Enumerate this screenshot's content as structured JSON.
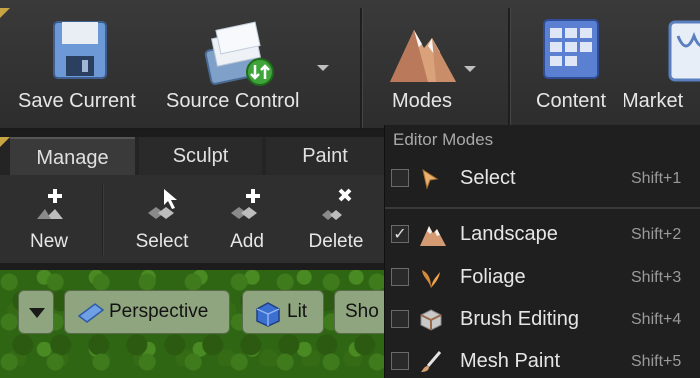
{
  "toolbar": {
    "save_current": "Save Current",
    "source_control": "Source Control",
    "modes": "Modes",
    "content": "Content",
    "marketplace": "Market"
  },
  "mode_tabs": [
    "Manage",
    "Sculpt",
    "Paint"
  ],
  "tools": [
    "New",
    "Select",
    "Add",
    "Delete"
  ],
  "viewport": {
    "perspective": "Perspective",
    "lit": "Lit",
    "show": "Sho"
  },
  "editor_modes": {
    "title": "Editor Modes",
    "items": [
      {
        "label": "Select",
        "shortcut": "Shift+1",
        "checked": false,
        "icon": "select-arrow-icon"
      },
      {
        "label": "Landscape",
        "shortcut": "Shift+2",
        "checked": true,
        "icon": "landscape-icon"
      },
      {
        "label": "Foliage",
        "shortcut": "Shift+3",
        "checked": false,
        "icon": "foliage-icon"
      },
      {
        "label": "Brush Editing",
        "shortcut": "Shift+4",
        "checked": false,
        "icon": "brush-editing-icon"
      },
      {
        "label": "Mesh Paint",
        "shortcut": "Shift+5",
        "checked": false,
        "icon": "mesh-paint-icon"
      }
    ]
  },
  "colors": {
    "accent_gold": "#c9a443",
    "toolbar_bg": "#333333",
    "menu_bg": "#1f1f1f",
    "viewport_green": "#2f6614"
  }
}
